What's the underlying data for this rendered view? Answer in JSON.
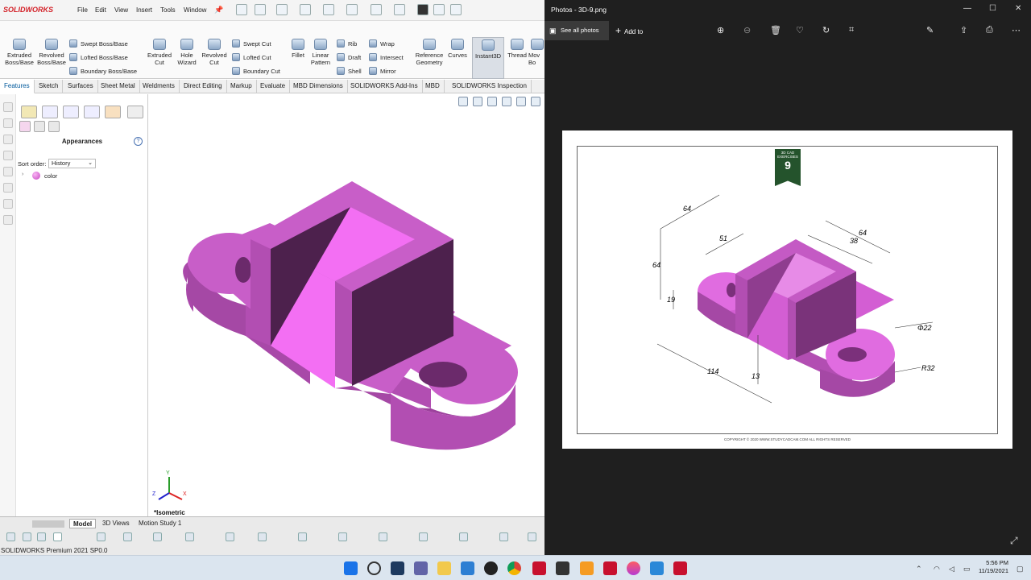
{
  "sw": {
    "app_name": "SOLIDWORKS",
    "menus": [
      "File",
      "Edit",
      "View",
      "Insert",
      "Tools",
      "Window"
    ],
    "features": {
      "extruded_boss": "Extruded Boss/Base",
      "revolved_boss": "Revolved Boss/Base",
      "swept_boss": "Swept Boss/Base",
      "lofted_boss": "Lofted Boss/Base",
      "boundary_boss": "Boundary Boss/Base",
      "extruded_cut": "Extruded Cut",
      "hole_wizard": "Hole Wizard",
      "revolved_cut": "Revolved Cut",
      "swept_cut": "Swept Cut",
      "lofted_cut": "Lofted Cut",
      "boundary_cut": "Boundary Cut",
      "fillet": "Fillet",
      "linear_pattern": "Linear Pattern",
      "rib": "Rib",
      "draft": "Draft",
      "shell": "Shell",
      "wrap": "Wrap",
      "intersect": "Intersect",
      "mirror": "Mirror",
      "reference_geometry": "Reference Geometry",
      "curves": "Curves",
      "instant3d": "Instant3D",
      "thread": "Thread",
      "move": "Mov Bo"
    },
    "tabs": [
      "Features",
      "Sketch",
      "Surfaces",
      "Sheet Metal",
      "Weldments",
      "Direct Editing",
      "Markup",
      "Evaluate",
      "MBD Dimensions",
      "SOLIDWORKS Add-Ins",
      "MBD",
      "SOLIDWORKS Inspection"
    ],
    "panel": {
      "title": "Appearances",
      "sort_label": "Sort order:",
      "sort_value": "History",
      "tree_item": "color"
    },
    "viewport": {
      "view_label": "*Isometric",
      "axis_x": "X",
      "axis_y": "Y",
      "axis_z": "Z",
      "model_color": "#c85ec8"
    },
    "bottom_tabs": [
      "Model",
      "3D Views",
      "Motion Study 1"
    ],
    "status": "SOLIDWORKS Premium 2021 SP0.0"
  },
  "photos": {
    "title": "Photos - 3D-9.png",
    "see_all": "See all photos",
    "add_to": "Add to",
    "badge_text": "3D CAD EXERCISES",
    "badge_number": "9",
    "copyright": "COPYRIGHT © 2020 WWW.STUDYCADCAM.COM ALL RIGHTS RESERVED",
    "dims": {
      "d64a": "64",
      "d51": "51",
      "d64b": "64",
      "d38": "38",
      "d64c": "64",
      "d19": "19",
      "d114": "114",
      "d13": "13",
      "phi22": "Φ22",
      "r32": "R32"
    }
  },
  "taskbar": {
    "time": "5:56 PM",
    "date": "11/19/2021"
  }
}
